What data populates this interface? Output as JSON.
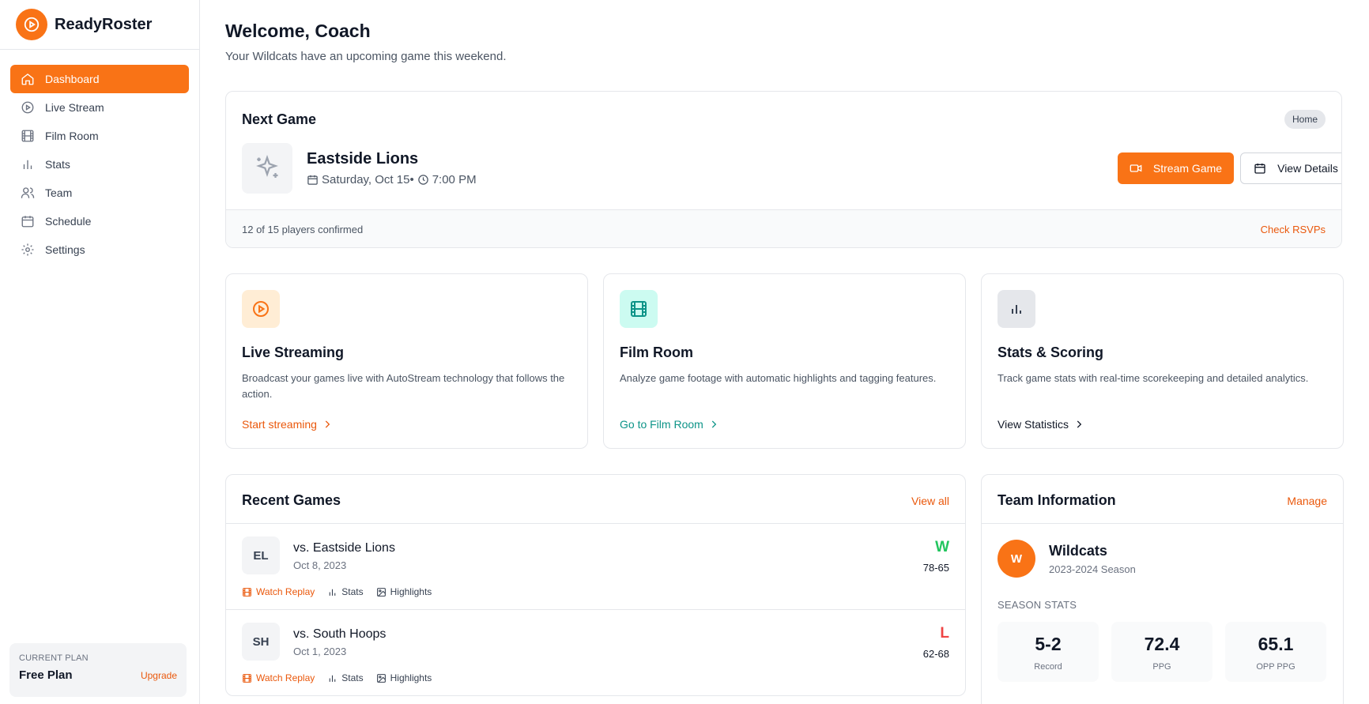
{
  "app": {
    "name": "ReadyRoster"
  },
  "colors": {
    "accent": "#f97316",
    "win": "#22c55e",
    "loss": "#ef4444",
    "teal": "#0d9488"
  },
  "sidebar": {
    "items": [
      {
        "label": "Dashboard",
        "icon": "home-icon",
        "active": true
      },
      {
        "label": "Live Stream",
        "icon": "play-circle-icon",
        "active": false
      },
      {
        "label": "Film Room",
        "icon": "film-icon",
        "active": false
      },
      {
        "label": "Stats",
        "icon": "bar-chart-icon",
        "active": false
      },
      {
        "label": "Team",
        "icon": "users-icon",
        "active": false
      },
      {
        "label": "Schedule",
        "icon": "calendar-icon",
        "active": false
      },
      {
        "label": "Settings",
        "icon": "gear-icon",
        "active": false
      }
    ],
    "plan": {
      "caption": "CURRENT PLAN",
      "name": "Free Plan",
      "upgrade": "Upgrade"
    }
  },
  "header": {
    "title": "Welcome, Coach",
    "subtitle": "Your Wildcats have an upcoming game this weekend."
  },
  "next_game": {
    "title": "Next Game",
    "badge": "Home",
    "opponent": "Eastside Lions",
    "date": "Saturday, Oct 15•",
    "time": "7:00 PM",
    "stream_button": "Stream Game",
    "details_button": "View Details",
    "confirmed": "12 of 15 players confirmed",
    "rsvp_link": "Check RSVPs"
  },
  "features": [
    {
      "title": "Live Streaming",
      "description": "Broadcast your games live with AutoStream technology that follows the action.",
      "link": "Start streaming",
      "icon": "play-circle-icon"
    },
    {
      "title": "Film Room",
      "description": "Analyze game footage with automatic highlights and tagging features.",
      "link": "Go to Film Room",
      "icon": "film-icon"
    },
    {
      "title": "Stats & Scoring",
      "description": "Track game stats with real-time scorekeeping and detailed analytics.",
      "link": "View Statistics",
      "icon": "bar-chart-icon"
    }
  ],
  "recent_games": {
    "title": "Recent Games",
    "view_all": "View all",
    "games": [
      {
        "initials": "EL",
        "opponent": "vs. Eastside Lions",
        "date": "Oct 8, 2023",
        "result": "W",
        "score": "78-65",
        "actions": [
          "Watch Replay",
          "Stats",
          "Highlights"
        ]
      },
      {
        "initials": "SH",
        "opponent": "vs. South Hoops",
        "date": "Oct 1, 2023",
        "result": "L",
        "score": "62-68",
        "actions": [
          "Watch Replay",
          "Stats",
          "Highlights"
        ]
      }
    ]
  },
  "team_info": {
    "title": "Team Information",
    "manage": "Manage",
    "initial": "W",
    "name": "Wildcats",
    "season": "2023-2024 Season",
    "stats_caption": "SEASON STATS",
    "stats": [
      {
        "value": "5-2",
        "label": "Record"
      },
      {
        "value": "72.4",
        "label": "PPG"
      },
      {
        "value": "65.1",
        "label": "OPP PPG"
      }
    ]
  }
}
